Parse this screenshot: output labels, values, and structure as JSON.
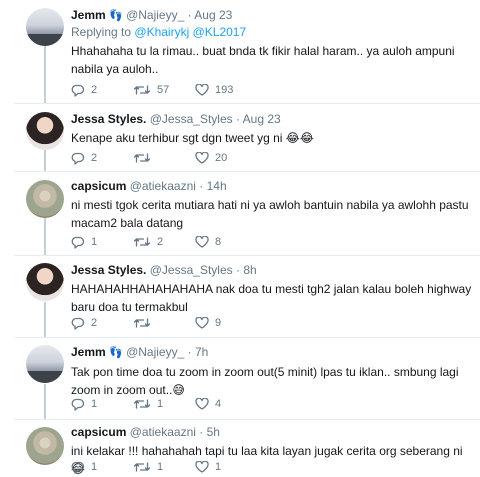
{
  "tweets": [
    {
      "name": "Jemm",
      "badge": "👣",
      "handle": "@Najieyy_",
      "time": "Aug 23",
      "reply_prefix": "Replying to",
      "reply_mentions": "@Khairykj @KL2017",
      "text": "Hhahahaha tu la rimau.. buat bnda tk fikir halal haram.. ya auloh ampuni nabila ya auloh..",
      "replies": "2",
      "retweets": "57",
      "likes": "193"
    },
    {
      "name": "Jessa Styles.",
      "badge": "",
      "handle": "@Jessa_Styles",
      "time": "Aug 23",
      "text": "Kenape aku terhibur sgt dgn tweet yg ni 😂😂",
      "replies": "2",
      "retweets": "",
      "likes": "20"
    },
    {
      "name": "capsicum",
      "badge": "",
      "handle": "@atiekaazni",
      "time": "14h",
      "text": "ni mesti tgok cerita mutiara hati ni ya awloh bantuin nabila ya awlohh pastu macam2 bala datang",
      "replies": "1",
      "retweets": "2",
      "likes": "8"
    },
    {
      "name": "Jessa Styles.",
      "badge": "",
      "handle": "@Jessa_Styles",
      "time": "8h",
      "text": "HAHAHAHHAHAHAHAHA nak doa tu mesti tgh2 jalan kalau boleh highway baru doa tu termakbul",
      "replies": "2",
      "retweets": "",
      "likes": "9"
    },
    {
      "name": "Jemm",
      "badge": "👣",
      "handle": "@Najieyy_",
      "time": "7h",
      "text": "Tak pon time doa tu zoom in zoom out(5 minit) lpas tu iklan.. smbung lagi zoom in zoom out..😅",
      "replies": "1",
      "retweets": "1",
      "likes": "4"
    },
    {
      "name": "capsicum",
      "badge": "",
      "handle": "@atiekaazni",
      "time": "5h",
      "text": "ini kelakar !!! hahahahah tapi tu laa kita layan jugak cerita org seberang ni😂",
      "replies": "1",
      "retweets": "1",
      "likes": "1"
    }
  ],
  "separator": "·",
  "icons": {
    "reply": "reply-icon",
    "retweet": "retweet-icon",
    "like": "heart-icon"
  },
  "colors": {
    "link": "#1da1f2",
    "muted": "#657786",
    "thread_line": "#c4cfd6"
  }
}
